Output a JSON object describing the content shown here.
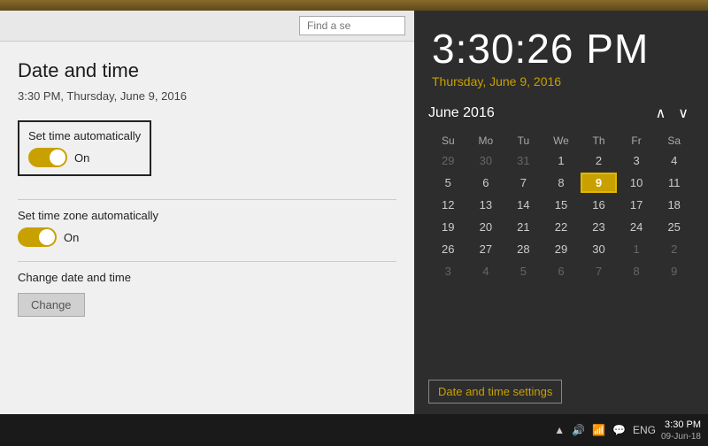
{
  "wallpaper": {
    "strip_color": "#8a6a2a"
  },
  "settings": {
    "title": "Date and time",
    "current_time_label": "3:30 PM, Thursday, June 9, 2016",
    "find_setting_placeholder": "Find a se",
    "set_time_auto": {
      "label": "Set time automatically",
      "state": "On"
    },
    "set_timezone_auto": {
      "label": "Set time zone automatically",
      "state": "On"
    },
    "change_section": {
      "label": "Change date and time",
      "button_label": "Change"
    }
  },
  "clock": {
    "time": "3:30:26 PM",
    "date": "Thursday, June 9, 2016"
  },
  "calendar": {
    "month_year": "June 2016",
    "days_header": [
      "Su",
      "Mo",
      "Tu",
      "We",
      "Th",
      "Fr",
      "Sa"
    ],
    "weeks": [
      [
        {
          "day": "29",
          "other": true
        },
        {
          "day": "30",
          "other": true
        },
        {
          "day": "31",
          "other": true
        },
        {
          "day": "1"
        },
        {
          "day": "2"
        },
        {
          "day": "3"
        },
        {
          "day": "4"
        }
      ],
      [
        {
          "day": "5"
        },
        {
          "day": "6"
        },
        {
          "day": "7"
        },
        {
          "day": "8"
        },
        {
          "day": "9",
          "today": true
        },
        {
          "day": "10"
        },
        {
          "day": "11"
        }
      ],
      [
        {
          "day": "12"
        },
        {
          "day": "13"
        },
        {
          "day": "14"
        },
        {
          "day": "15"
        },
        {
          "day": "16"
        },
        {
          "day": "17"
        },
        {
          "day": "18"
        }
      ],
      [
        {
          "day": "19"
        },
        {
          "day": "20"
        },
        {
          "day": "21"
        },
        {
          "day": "22"
        },
        {
          "day": "23"
        },
        {
          "day": "24"
        },
        {
          "day": "25"
        }
      ],
      [
        {
          "day": "26"
        },
        {
          "day": "27"
        },
        {
          "day": "28"
        },
        {
          "day": "29"
        },
        {
          "day": "30"
        },
        {
          "day": "1",
          "other": true
        },
        {
          "day": "2",
          "other": true
        }
      ],
      [
        {
          "day": "3",
          "other": true
        },
        {
          "day": "4",
          "other": true
        },
        {
          "day": "5",
          "other": true
        },
        {
          "day": "6",
          "other": true
        },
        {
          "day": "7",
          "other": true
        },
        {
          "day": "8",
          "other": true
        },
        {
          "day": "9",
          "other": true
        }
      ]
    ],
    "date_time_settings_btn": "Date and time settings",
    "nav_up": "∧",
    "nav_down": "∨"
  },
  "taskbar": {
    "time": "3:30 PM",
    "date": "09-Jun-18",
    "lang": "ENG"
  }
}
